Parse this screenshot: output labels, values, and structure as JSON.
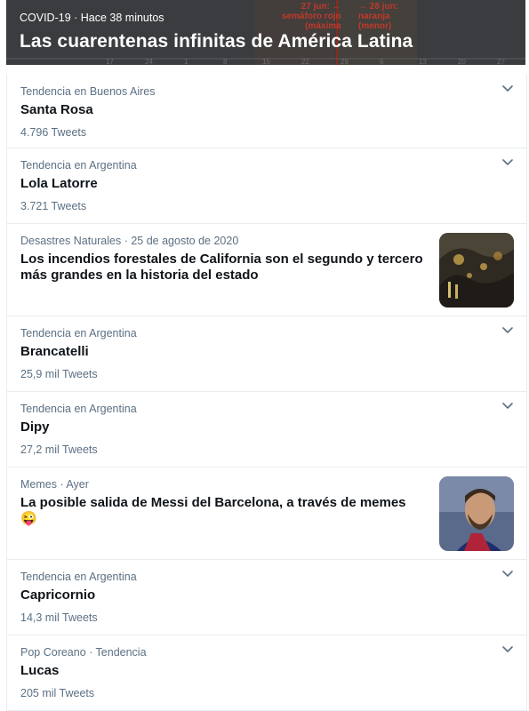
{
  "hero": {
    "meta": "COVID-19 · Hace 38 minutos",
    "title": "Las cuarentenas infinitas de América Latina",
    "chart_annotations": [
      "27 jun: ←",
      "semáforo rojo",
      "(máxima",
      "→ 28 jun:",
      "naranja",
      "(menor)"
    ],
    "axis_ticks": [
      "17",
      "24",
      "1",
      "8",
      "15",
      "22",
      "29",
      "6",
      "13",
      "20",
      "27"
    ]
  },
  "trends": [
    {
      "meta": "Tendencia en Buenos Aires",
      "name": "Santa Rosa",
      "count": "4.796 Tweets"
    },
    {
      "meta": "Tendencia en Argentina",
      "name": "Lola Latorre",
      "count": "3.721 Tweets"
    },
    {
      "meta": "Desastres Naturales · 25 de agosto de 2020",
      "headline": "Los incendios forestales de California son el segundo y tercero más grandes en la historia del estado",
      "thumb": "wildfire-photo"
    },
    {
      "meta": "Tendencia en Argentina",
      "name": "Brancatelli",
      "count": "25,9 mil Tweets"
    },
    {
      "meta": "Tendencia en Argentina",
      "name": "Dipy",
      "count": "27,2 mil Tweets"
    },
    {
      "meta": "Memes · Ayer",
      "headline": "La posible salida de Messi del Barcelona, a través de memes 😜",
      "thumb": "messi-photo"
    },
    {
      "meta": "Tendencia en Argentina",
      "name": "Capricornio",
      "count": "14,3 mil Tweets"
    },
    {
      "meta": "Pop Coreano · Tendencia",
      "name": "Lucas",
      "count": "205 mil Tweets"
    }
  ],
  "icons": {
    "more": "chevron-down-icon"
  },
  "colors": {
    "secondary_text": "#5b7083",
    "primary_text": "#0f1419",
    "divider": "#e6ecf0"
  }
}
